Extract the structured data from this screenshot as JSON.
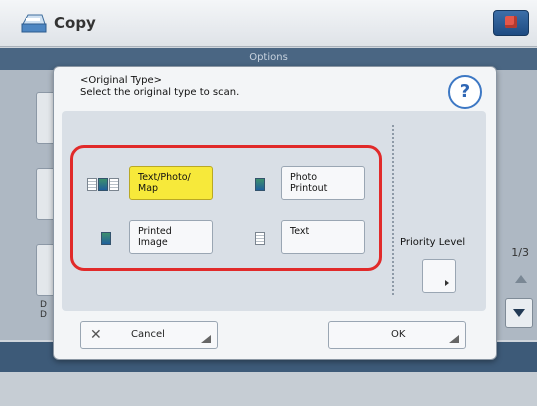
{
  "header": {
    "app_title": "Copy",
    "app_icon": "copy-machine-icon",
    "corner_icon": "cube-icon"
  },
  "background": {
    "options_label": "Options",
    "side_text": "D\nD",
    "page_indicator": "1/3"
  },
  "dialog": {
    "title": "<Original Type>",
    "subtitle": "Select the original type to scan.",
    "help_label": "?",
    "options": [
      {
        "label": "Text/Photo/\nMap",
        "icon": "text-photo-map-icon",
        "selected": true
      },
      {
        "label": "Photo\nPrintout",
        "icon": "photo-printout-icon",
        "selected": false
      },
      {
        "label": "Printed Image",
        "icon": "printed-image-icon",
        "selected": false
      },
      {
        "label": "Text",
        "icon": "text-document-icon",
        "selected": false
      }
    ],
    "priority_level_label": "Priority Level",
    "cancel_label": "Cancel",
    "ok_label": "OK"
  },
  "colors": {
    "highlight": "#e12a2a",
    "selected": "#f7e93a",
    "help_ring": "#3d78c4"
  }
}
